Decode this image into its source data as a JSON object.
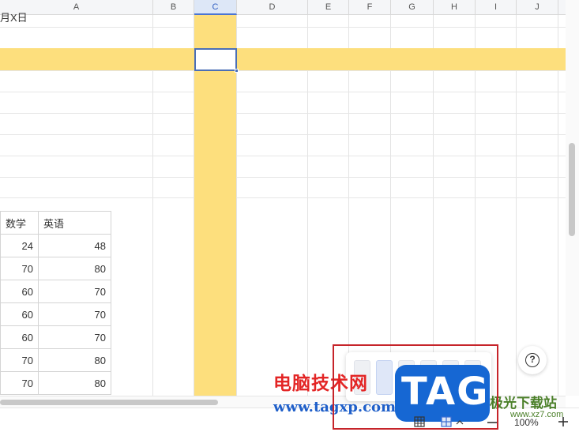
{
  "sheet": {
    "columns": [
      "A",
      "B",
      "C",
      "D",
      "E",
      "F",
      "G",
      "H",
      "I",
      "J"
    ],
    "active_column": "C",
    "top_fragment": "月X日"
  },
  "table": {
    "headers": [
      "数学",
      "英语"
    ],
    "rows": [
      [
        "24",
        "48"
      ],
      [
        "70",
        "80"
      ],
      [
        "60",
        "70"
      ],
      [
        "60",
        "70"
      ],
      [
        "60",
        "70"
      ],
      [
        "70",
        "80"
      ],
      [
        "70",
        "80"
      ]
    ]
  },
  "status": {
    "zoom": "100%",
    "zoom_out_icon": "minus-icon",
    "zoom_in_icon": "plus-icon"
  },
  "help": {
    "label": "?"
  },
  "watermark": {
    "brand_cn": "电脑技术网",
    "url": "www.tagxp.com",
    "badge": "TAG",
    "site_cn": "极光下载站",
    "site_url": "www.xz7.com"
  },
  "colors": {
    "highlight": "#fddf7d",
    "selection": "#4b6fb6",
    "annotation_box": "#c6242a"
  }
}
